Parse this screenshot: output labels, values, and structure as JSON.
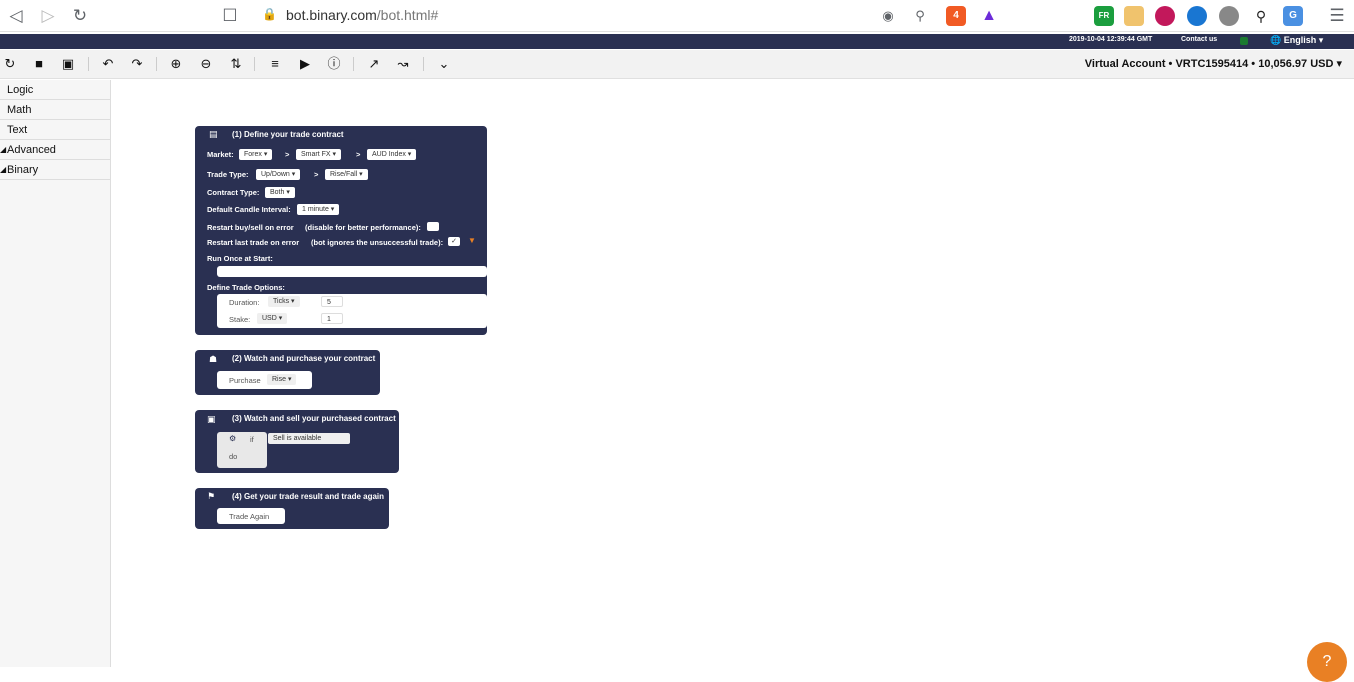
{
  "browser": {
    "url_host": "bot.binary.com",
    "url_path": "/bot.html#",
    "brave_badge": "4",
    "fr_badge": "FR"
  },
  "site_header": {
    "timestamp": "2019-10-04 12:39:44 GMT",
    "contact": "Contact us",
    "language": "English"
  },
  "toolbar": {
    "account_label": "Virtual Account",
    "account_id": "VRTC1595414",
    "balance": "10,056.97 USD"
  },
  "sidebar": {
    "items": [
      {
        "label": "Logic",
        "expandable": false
      },
      {
        "label": "Math",
        "expandable": false
      },
      {
        "label": "Text",
        "expandable": false
      },
      {
        "label": "Advanced",
        "expandable": true
      },
      {
        "label": "Binary",
        "expandable": true
      }
    ]
  },
  "block1": {
    "title": "(1) Define your trade contract",
    "market_label": "Market:",
    "market": "Forex",
    "submarket": "Smart FX",
    "symbol": "AUD Index",
    "sep": ">",
    "trade_type_label": "Trade Type:",
    "trade_type": "Up/Down",
    "trade_subtype": "Rise/Fall",
    "contract_type_label": "Contract Type:",
    "contract_type": "Both",
    "candle_label": "Default Candle Interval:",
    "candle": "1 minute",
    "restart_buysell_label": "Restart buy/sell on error",
    "restart_buysell_note": "(disable for better performance):",
    "restart_trade_label": "Restart last trade on error",
    "restart_trade_note": "(bot ignores the unsuccessful trade):",
    "restart_trade_checked": "✓",
    "run_once_label": "Run Once at Start:",
    "trade_options_label": "Define Trade Options:",
    "duration_label": "Duration:",
    "duration_unit": "Ticks",
    "duration_value": "5",
    "stake_label": "Stake:",
    "stake_currency": "USD",
    "stake_value": "1"
  },
  "block2": {
    "title": "(2) Watch and purchase your contract",
    "purchase_label": "Purchase",
    "purchase_value": "Rise"
  },
  "block3": {
    "title": "(3) Watch and sell your purchased contract",
    "if_label": "if",
    "condition": "Sell is available",
    "do_label": "do"
  },
  "block4": {
    "title": "(4) Get your trade result and trade again",
    "trade_again": "Trade Again"
  },
  "colors": {
    "block_bg": "#2a3052",
    "help_button": "#e98024",
    "status_online": "#1b7a31"
  }
}
